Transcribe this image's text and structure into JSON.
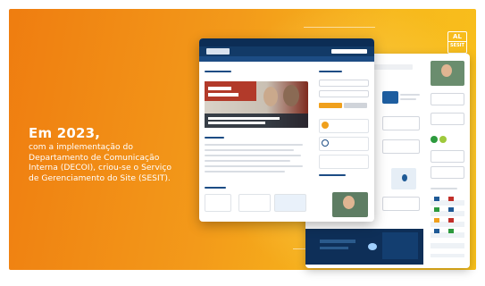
{
  "headline": "Em 2023,",
  "body_lines": [
    "com a implementação do",
    "Departamento de Comunicação",
    "Interna (DECOI), criou-se o Serviço",
    "de Gerenciamento do Site (SESIT)."
  ],
  "logo_text": "AL",
  "logo_sub": "SESIT",
  "colors": {
    "gradient_start": "#ef7d10",
    "gradient_end": "#f8c01b",
    "site_navy": "#0c2d55",
    "site_blue": "#1c4c84",
    "site_orange": "#f0a01c",
    "site_red": "#b23a2a",
    "text_white": "#ffffff"
  },
  "icons": [
    "site-screenshot-front",
    "site-screenshot-back",
    "institution-logo-icon"
  ]
}
